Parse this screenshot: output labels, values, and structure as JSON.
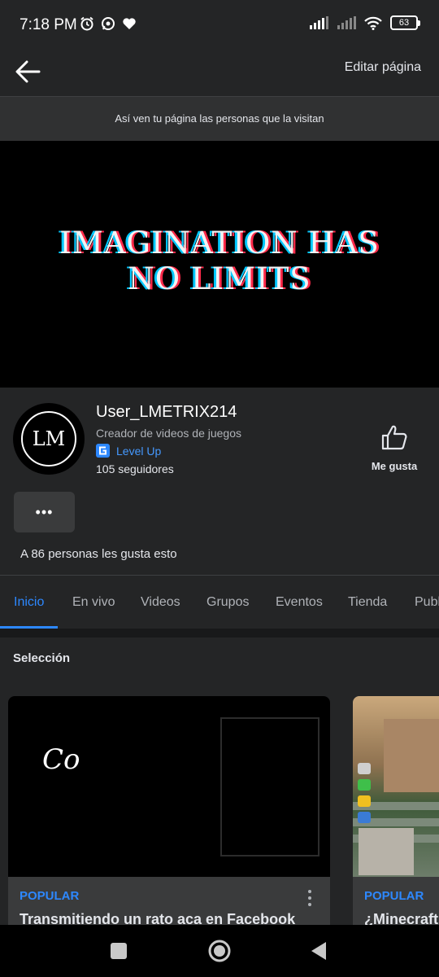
{
  "status_bar": {
    "time": "7:18 PM",
    "battery": "63"
  },
  "appbar": {
    "edit_label": "Editar página"
  },
  "preview_banner": {
    "text": "Así ven tu página las personas que la visitan"
  },
  "cover": {
    "line1": "IMAGINATION HAS",
    "line2": "NO LIMITS"
  },
  "profile": {
    "avatar_text": "LM",
    "name": "User_LMETRIX214",
    "category": "Creador de videos de juegos",
    "level": "Level Up",
    "followers": "105 seguidores",
    "like_label": "Me gusta",
    "more_label": "•••",
    "likes_count": "A 86 personas les gusta esto"
  },
  "tabs": [
    {
      "label": "Inicio",
      "active": true
    },
    {
      "label": "En vivo"
    },
    {
      "label": "Videos"
    },
    {
      "label": "Grupos"
    },
    {
      "label": "Eventos"
    },
    {
      "label": "Tienda"
    },
    {
      "label": "Publ"
    }
  ],
  "section": {
    "title": "Selección",
    "cards": [
      {
        "thumb_text": "Co",
        "tag": "POPULAR",
        "title": "Transmitiendo un rato aca en Facebook"
      },
      {
        "tag": "POPULAR",
        "title": "¿Minecraft"
      }
    ]
  },
  "colors": {
    "accent": "#2d88ff",
    "background": "#18191a",
    "surface": "#242526"
  }
}
